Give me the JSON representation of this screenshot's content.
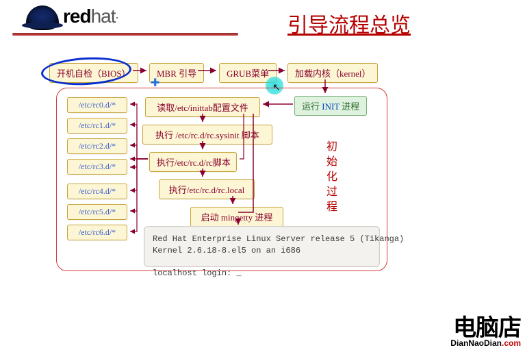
{
  "header": {
    "logo_red": "red",
    "logo_hat": "hat",
    "logo_period": ".",
    "title": "引导流程总览"
  },
  "top_row": {
    "bios": "开机自检（BIOS）",
    "mbr": "MBR 引导",
    "grub": "GRUB菜单",
    "kernel": "加载内核（kernel）"
  },
  "init_box": {
    "prefix": "运行 ",
    "accent": "INIT",
    "suffix": " 进程"
  },
  "steps": {
    "inittab": "读取/etc/inittab配置文件",
    "rc_sysinit": "执行 /etc/rc.d/rc.sysinit 脚本",
    "rc": "执行/etc/rc.d/rc脚本",
    "rc_local": "执行/etc/rc.d/rc.local",
    "mingetty": "启动 mingetty 进程"
  },
  "side_items": [
    "/etc/rc0.d/*",
    "/etc/rc1.d/*",
    "/etc/rc2.d/*",
    "/etc/rc3.d/*",
    "/etc/rc4.d/*",
    "/etc/rc5.d/*",
    "/etc/rc6.d/*"
  ],
  "terminal": "Red Hat Enterprise Linux Server release 5 (Tikanga)\nKernel 2.6.18-8.el5 on an i686\n\nlocalhost login: _",
  "side_label": "初始化过程",
  "watermark": {
    "cn": "电脑店",
    "en_a": "DianNaoDian",
    "en_b": ".com"
  }
}
